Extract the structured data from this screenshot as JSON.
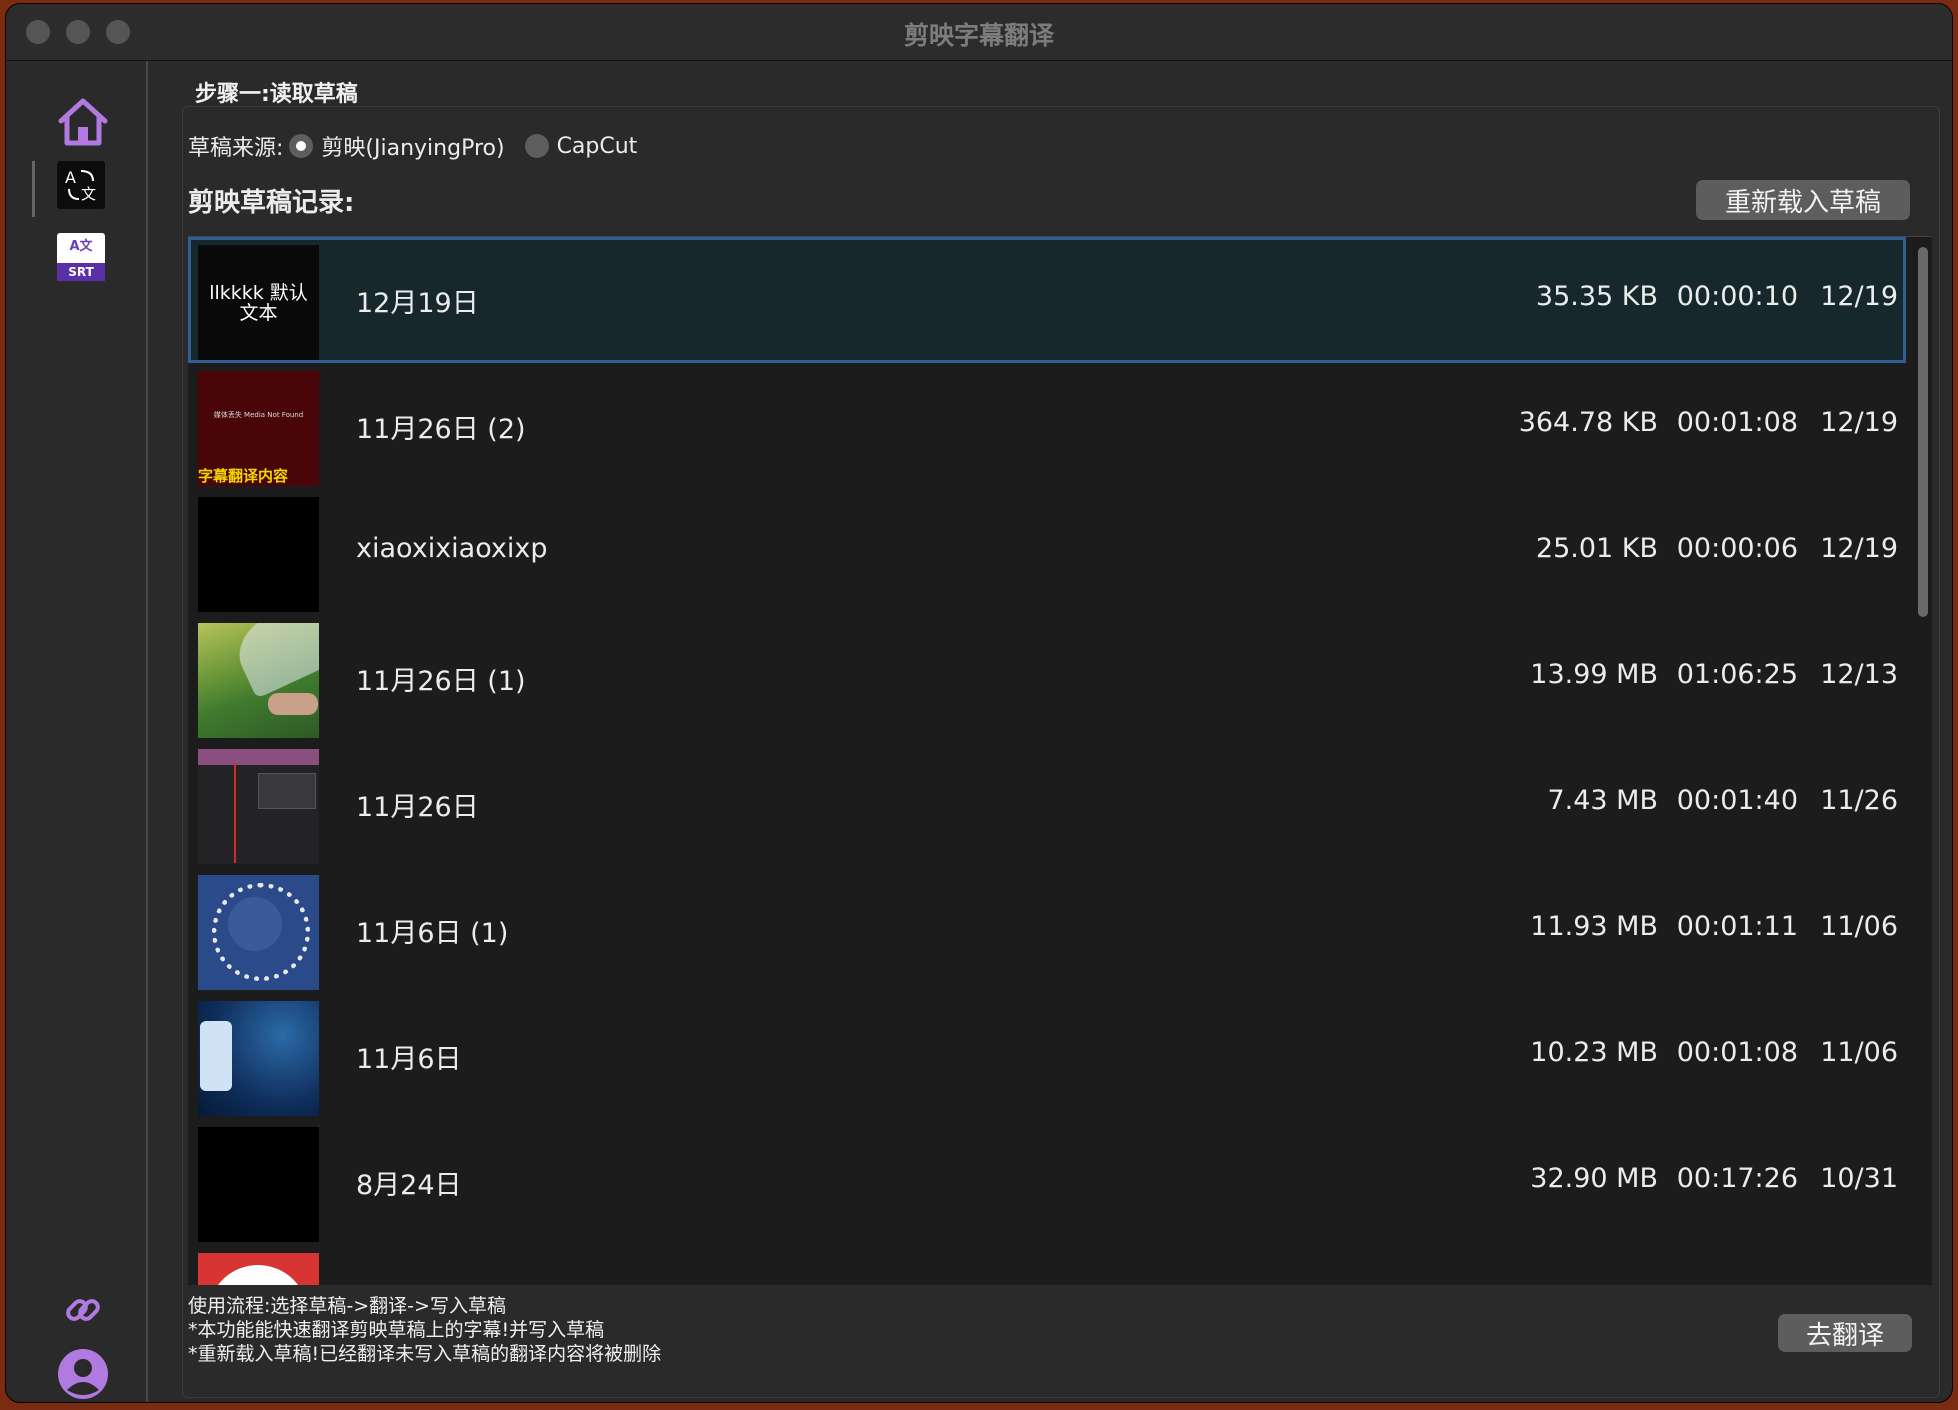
{
  "window": {
    "title": "剪映字幕翻译"
  },
  "sidebar": {
    "items": [
      {
        "name": "home",
        "icon": "home-icon"
      },
      {
        "name": "translate",
        "icon": "translate-icon"
      },
      {
        "name": "srt",
        "icon": "srt-translate-icon",
        "badge": "SRT",
        "glyph": "A文"
      },
      {
        "name": "link",
        "icon": "link-icon"
      },
      {
        "name": "account",
        "icon": "user-avatar-icon"
      }
    ],
    "accent": "#b07ae0"
  },
  "main": {
    "step_title": "步骤一:读取草稿",
    "source_label": "草稿来源:",
    "sources": [
      {
        "label": "剪映(JianyingPro)",
        "selected": true
      },
      {
        "label": "CapCut",
        "selected": false
      }
    ],
    "records_label": "剪映草稿记录:",
    "reload_button": "重新载入草稿",
    "drafts": [
      {
        "name": "12月19日",
        "size": "35.35 KB",
        "duration": "00:00:10",
        "date": "12/19",
        "selected": true,
        "thumb_text": "llkkkk 默认文本"
      },
      {
        "name": "11月26日 (2)",
        "size": "364.78 KB",
        "duration": "00:01:08",
        "date": "12/19",
        "thumb_text": "媒体丢失 Media Not Found",
        "thumb_caption": "字幕翻译内容"
      },
      {
        "name": "xiaoxixiaoxixp",
        "size": "25.01 KB",
        "duration": "00:00:06",
        "date": "12/19"
      },
      {
        "name": "11月26日 (1)",
        "size": "13.99 MB",
        "duration": "01:06:25",
        "date": "12/13"
      },
      {
        "name": "11月26日",
        "size": "7.43 MB",
        "duration": "00:01:40",
        "date": "11/26"
      },
      {
        "name": "11月6日 (1)",
        "size": "11.93 MB",
        "duration": "00:01:11",
        "date": "11/06"
      },
      {
        "name": "11月6日",
        "size": "10.23 MB",
        "duration": "00:01:08",
        "date": "11/06"
      },
      {
        "name": "8月24日",
        "size": "32.90 MB",
        "duration": "00:17:26",
        "date": "10/31"
      }
    ],
    "notes": [
      "使用流程:选择草稿->翻译->写入草稿",
      "*本功能能快速翻译剪映草稿上的字幕!并写入草稿",
      "*重新载入草稿!已经翻译未写入草稿的翻译内容将被删除"
    ],
    "translate_button": "去翻译"
  }
}
